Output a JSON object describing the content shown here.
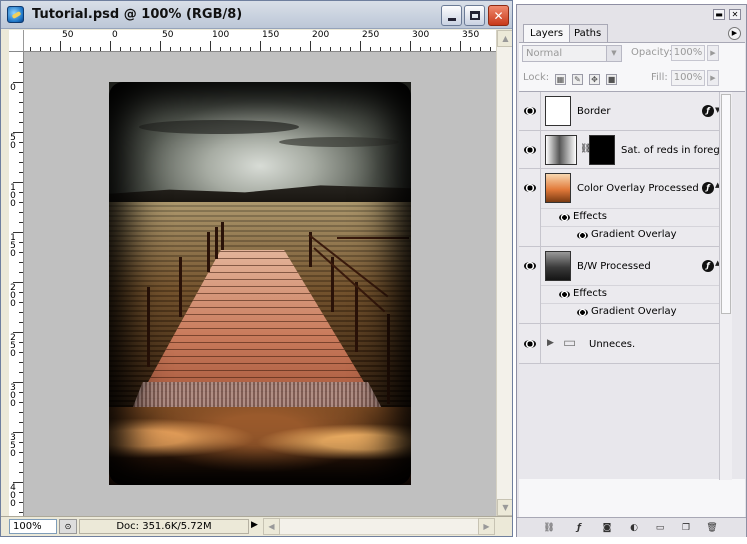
{
  "document": {
    "title": "Tutorial.psd @ 100% (RGB/8)",
    "zoom": "100%",
    "doc_size": "Doc: 351.6K/5.72M"
  },
  "rulers": {
    "top_labels": [
      "50",
      "0",
      "50",
      "100",
      "150",
      "200",
      "250",
      "300",
      "350"
    ],
    "left_labels": [
      "0",
      "5 0",
      "1 0 0",
      "1 5 0",
      "2 0 0",
      "2 5 0",
      "3 0 0",
      "3 5 0",
      "4 0 0"
    ]
  },
  "palette": {
    "tabs": [
      {
        "label": "Layers"
      },
      {
        "label": "Paths"
      }
    ],
    "blend_mode": "Normal",
    "opacity_label": "Opacity:",
    "opacity_value": "100%",
    "lock_label": "Lock:",
    "fill_label": "Fill:",
    "fill_value": "100%",
    "layers": [
      {
        "name": "Border",
        "fx": true,
        "visible": true
      },
      {
        "name": "Sat. of reds in foregr...",
        "fx": false,
        "visible": true
      },
      {
        "name": "Color Overlay Processed",
        "fx": true,
        "visible": true,
        "effects_label": "Effects",
        "effect": "Gradient Overlay"
      },
      {
        "name": "B/W Processed",
        "fx": true,
        "visible": true,
        "effects_label": "Effects",
        "effect": "Gradient Overlay"
      },
      {
        "name": "Unneces.",
        "group": true,
        "visible": true
      }
    ],
    "fx_symbol": "ƒ"
  },
  "colors": {
    "canvas_bg": "#c0c0c0",
    "palette_bg": "#e4e3e8",
    "close_button": "#c8391a"
  }
}
